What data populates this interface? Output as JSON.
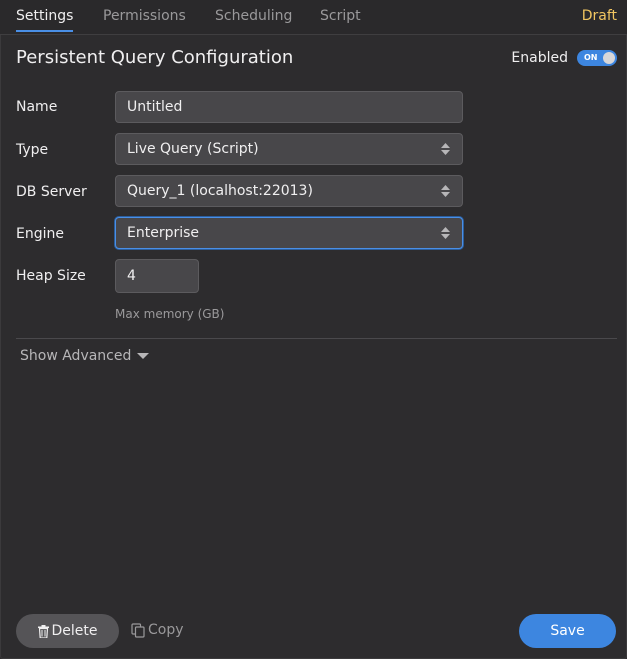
{
  "tabs": [
    {
      "label": "Settings",
      "active": true
    },
    {
      "label": "Permissions",
      "active": false
    },
    {
      "label": "Scheduling",
      "active": false
    },
    {
      "label": "Script",
      "active": false
    }
  ],
  "status": "Draft",
  "title": "Persistent Query Configuration",
  "enabled": {
    "label": "Enabled",
    "toggle_text": "ON",
    "value": true
  },
  "form": {
    "name": {
      "label": "Name",
      "value": "Untitled"
    },
    "type": {
      "label": "Type",
      "value": "Live Query (Script)"
    },
    "db_server": {
      "label": "DB Server",
      "value": "Query_1 (localhost:22013)"
    },
    "engine": {
      "label": "Engine",
      "value": "Enterprise"
    },
    "heap_size": {
      "label": "Heap Size",
      "value": "4",
      "hint": "Max memory (GB)"
    }
  },
  "advanced_label": "Show Advanced",
  "footer": {
    "delete_label": "Delete",
    "copy_label": "Copy",
    "save_label": "Save"
  },
  "colors": {
    "background": "#2d2c2e",
    "accent": "#3d86e0",
    "draft": "#f2c661"
  }
}
